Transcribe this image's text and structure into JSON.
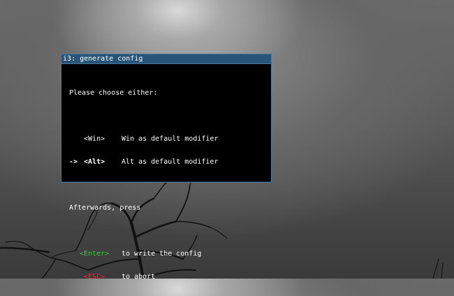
{
  "window": {
    "title": "i3: generate config"
  },
  "prompt": "Please choose either:",
  "options": [
    {
      "marker": "   ",
      "key": "<Win>",
      "desc": "Win as default modifier",
      "selected": false
    },
    {
      "marker": "-> ",
      "key": "<Alt>",
      "desc": "Alt as default modifier",
      "selected": true
    }
  ],
  "afterwards": "Afterwards, press",
  "actions": [
    {
      "key": "<Enter>",
      "desc": "to write the config",
      "color": "#33cc33"
    },
    {
      "key": "<ESC>",
      "desc": "to abort",
      "color": "#ff2222"
    }
  ]
}
